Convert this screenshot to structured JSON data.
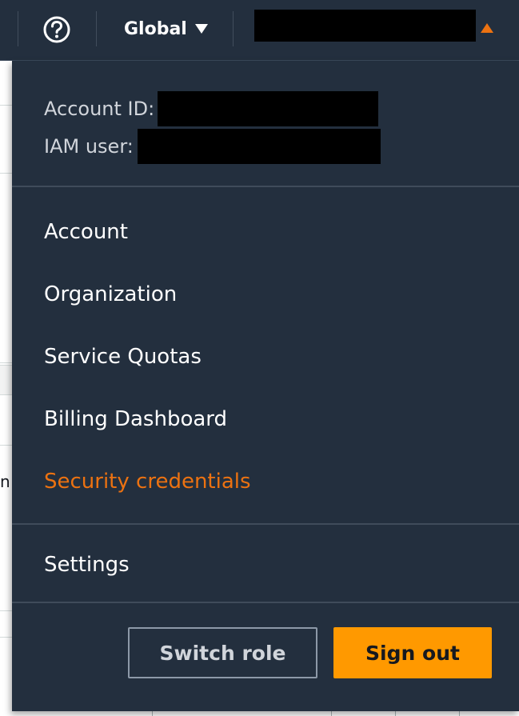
{
  "navbar": {
    "help_icon": "help-circle-icon",
    "region_label": "Global",
    "region_caret_icon": "caret-down-icon",
    "account_caret_icon": "caret-up-icon",
    "accent_color": "#ec7211"
  },
  "account_info": {
    "account_id_label": "Account ID:",
    "iam_user_label": "IAM user:"
  },
  "menu": {
    "items": [
      {
        "label": "Account"
      },
      {
        "label": "Organization"
      },
      {
        "label": "Service Quotas"
      },
      {
        "label": "Billing Dashboard"
      },
      {
        "label": "Security credentials",
        "active": true
      }
    ],
    "settings_label": "Settings"
  },
  "actions": {
    "switch_role_label": "Switch role",
    "sign_out_label": "Sign out",
    "primary_color": "#ff9900"
  },
  "background": {
    "partial_text": "n"
  }
}
